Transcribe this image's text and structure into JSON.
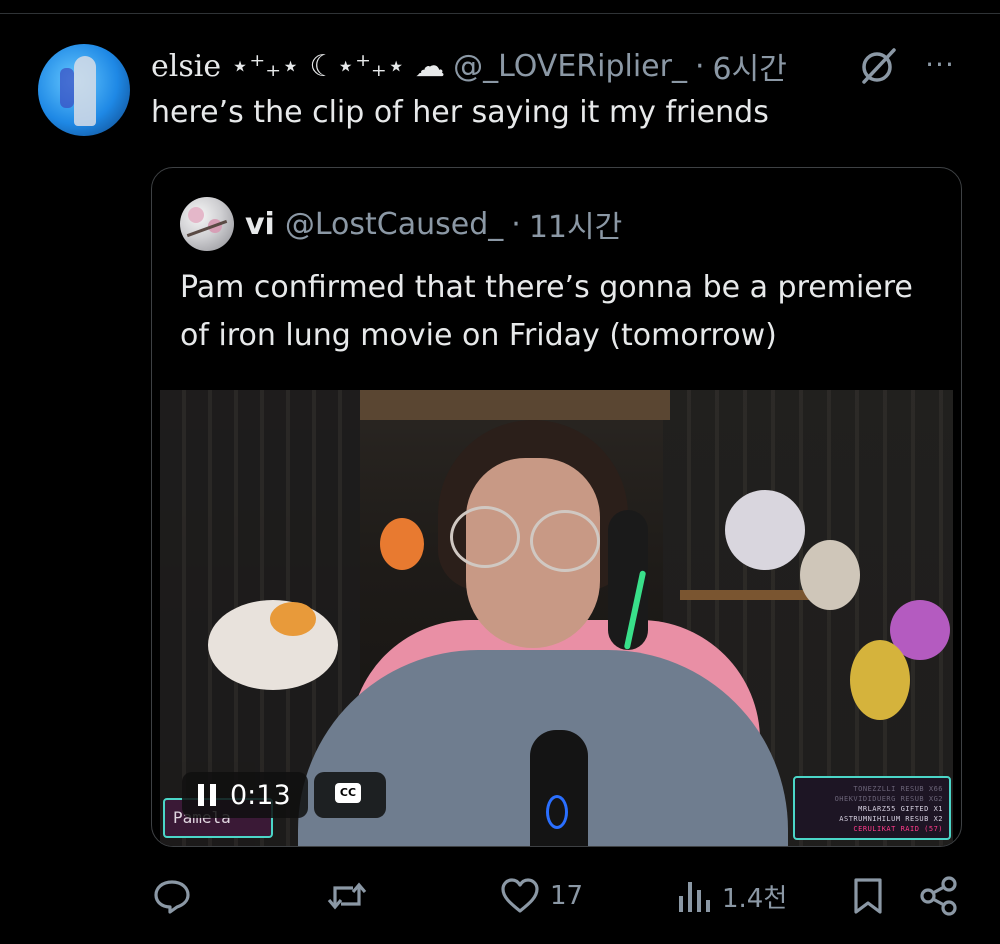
{
  "post": {
    "author_name": "elsie ⋆⁺₊⋆ ☾⋆⁺₊⋆ ☁",
    "handle": "@_LOVERiplier_",
    "separator": "·",
    "time": "6시간",
    "text": "here’s the clip of her saying it my friends",
    "more_label": "···"
  },
  "quote": {
    "author_name": "vi",
    "handle": "@LostCaused_",
    "separator": "·",
    "time": "11시간",
    "text": "Pam confirmed that there’s gonna be a premiere of iron lung movie on Friday (tomorrow)",
    "video": {
      "timestamp": "0:13",
      "cc_label": "CC",
      "nameplate": "Pamela",
      "overlay_lines": [
        "TONEZZLLI RESUB X66",
        "OHEKVIDIDUERG RESUB XG2",
        "MRLARZ55 GIFTED X1",
        "ASTRUMNIHILUM RESUB X2",
        "CERULIKAT RAID (57)"
      ]
    }
  },
  "actions": {
    "reply_count": "",
    "repost_count": "",
    "like_count": "17",
    "views_count": "1.4천"
  },
  "colors": {
    "background": "#000000",
    "text": "#e7e9ea",
    "muted": "#8b98a5",
    "border": "#3e4144"
  }
}
